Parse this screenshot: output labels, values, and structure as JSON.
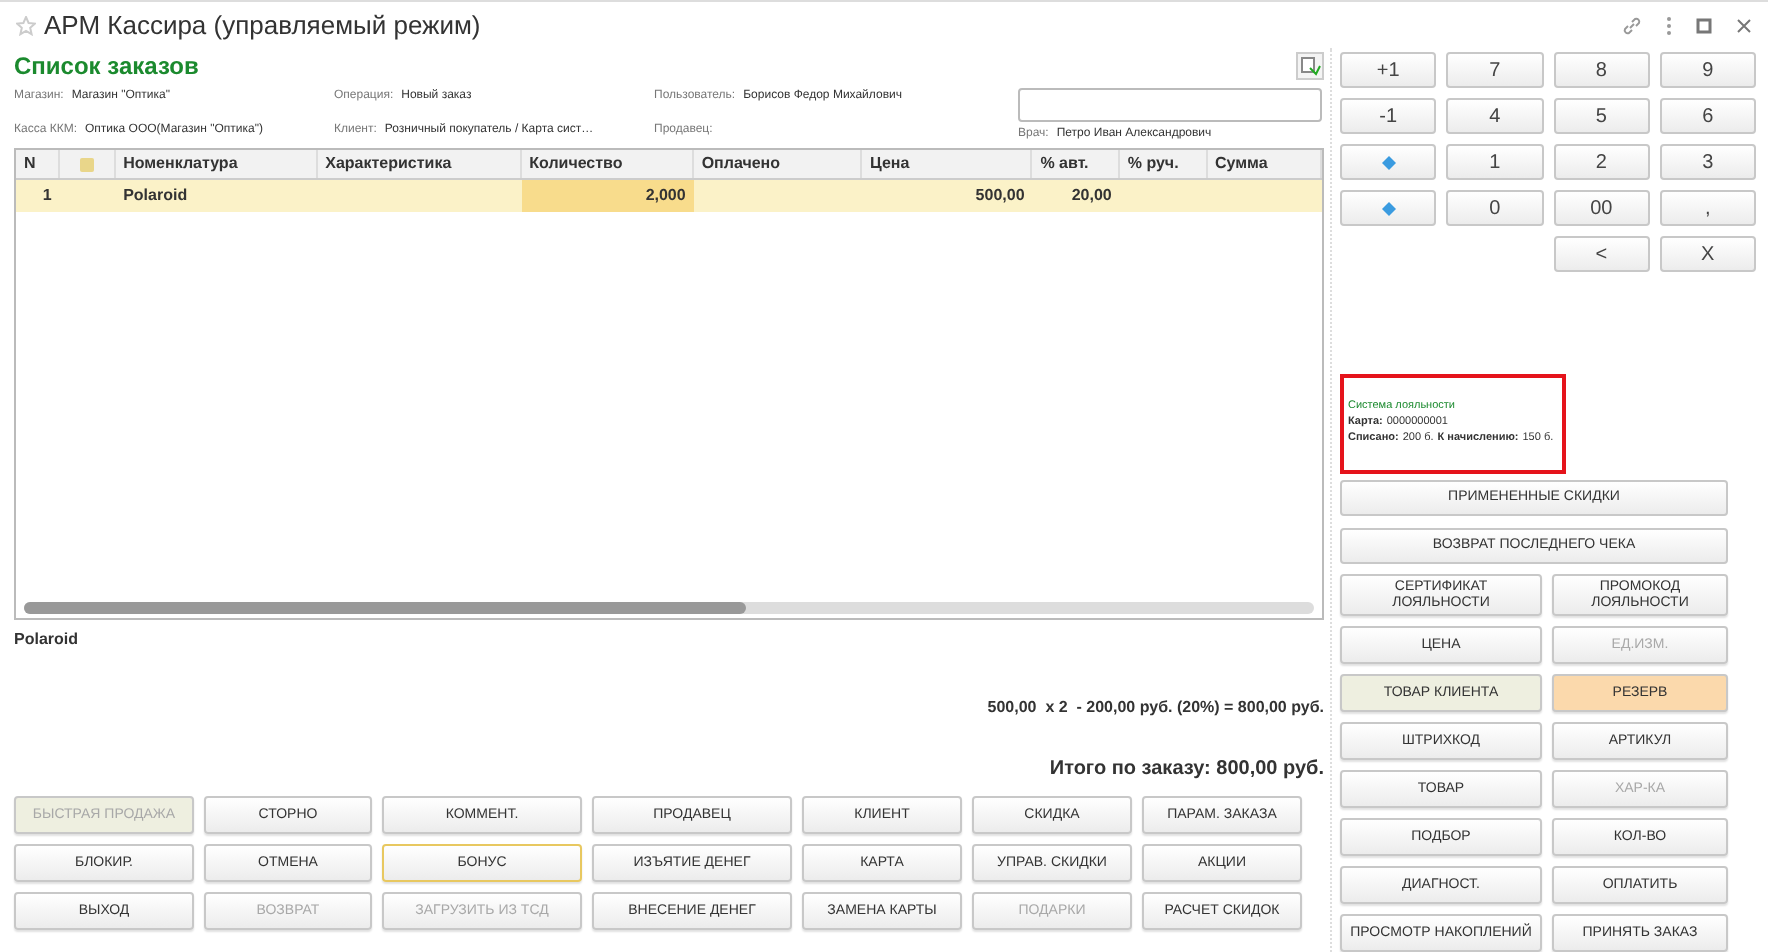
{
  "window": {
    "title": "АРМ Кассира (управляемый режим)"
  },
  "form": {
    "title": "Список заказов"
  },
  "info": [
    {
      "label": "Магазин:",
      "value": "Магазин \"Оптика\""
    },
    {
      "label": "Операция:",
      "value": "Новый заказ"
    },
    {
      "label": "Пользователь:",
      "value": "Борисов Федор Михайлович"
    },
    {
      "label": "Касса ККМ:",
      "value": "Оптика ООО(Магазин \"Оптика\")"
    },
    {
      "label": "Клиент:",
      "value": "Розничный покупатель / Карта сист…"
    },
    {
      "label": "Продавец:"
    }
  ],
  "doctor": {
    "label": "Врач:",
    "value": "Петро Иван Александрович"
  },
  "table": {
    "columns": [
      "N",
      "Номенклатура",
      "Характеристика",
      "Количество",
      "Оплачено",
      "Цена",
      "% авт.",
      "% руч.",
      "Сумма"
    ],
    "rows": [
      {
        "selected": true,
        "cells": [
          {
            "text": "1",
            "focused": false
          },
          {
            "text": "Polaroid",
            "focused": false
          },
          {
            "focused": false
          },
          {
            "text": "2,000",
            "focused": true
          },
          {
            "focused": false
          },
          {
            "text": "500,00",
            "focused": false
          },
          {
            "text": "20,00",
            "focused": false
          },
          {
            "focused": false
          },
          {
            "focused": false
          }
        ]
      }
    ]
  },
  "summary": {
    "item": "Polaroid",
    "calc": "500,00  x 2  - 200,00 руб. (20%) = 800,00 руб.",
    "total": "Итого по заказу: 800,00 руб."
  },
  "bottom_buttons": [
    {
      "label": "БЫСТРАЯ ПРОДАЖА",
      "kind": "olive",
      "disabled": true,
      "focused": false
    },
    {
      "label": "СТОРНО",
      "kind": "plain",
      "disabled": false,
      "focused": false
    },
    {
      "label": "КОММЕНТ.",
      "kind": "plain",
      "disabled": false,
      "focused": false
    },
    {
      "label": "ПРОДАВЕЦ",
      "kind": "plain",
      "disabled": false,
      "focused": false
    },
    {
      "label": "КЛИЕНТ",
      "kind": "plain",
      "disabled": false,
      "focused": false
    },
    {
      "label": "СКИДКА",
      "kind": "plain",
      "disabled": false,
      "focused": false
    },
    {
      "label": "ПАРАМ. ЗАКАЗА",
      "kind": "plain",
      "disabled": false,
      "focused": false
    },
    {
      "label": "БЛОКИР.",
      "kind": "plain",
      "disabled": false,
      "focused": false
    },
    {
      "label": "ОТМЕНА",
      "kind": "plain",
      "disabled": false,
      "focused": false
    },
    {
      "label": "БОНУС",
      "kind": "plain",
      "disabled": false,
      "focused": true
    },
    {
      "label": "ИЗЪЯТИЕ ДЕНЕГ",
      "kind": "plain",
      "disabled": false,
      "focused": false
    },
    {
      "label": "КАРТА",
      "kind": "plain",
      "disabled": false,
      "focused": false
    },
    {
      "label": "УПРАВ. СКИДКИ",
      "kind": "plain",
      "disabled": false,
      "focused": false
    },
    {
      "label": "АКЦИИ",
      "kind": "plain",
      "disabled": false,
      "focused": false
    },
    {
      "label": "ВЫХОД",
      "kind": "plain",
      "disabled": false,
      "focused": false
    },
    {
      "label": "ВОЗВРАТ",
      "kind": "plain",
      "disabled": true,
      "focused": false
    },
    {
      "label": "ЗАГРУЗИТЬ ИЗ ТСД",
      "kind": "plain",
      "disabled": true,
      "focused": false
    },
    {
      "label": "ВНЕСЕНИЕ ДЕНЕГ",
      "kind": "plain",
      "disabled": false,
      "focused": false
    },
    {
      "label": "ЗАМЕНА КАРТЫ",
      "kind": "plain",
      "disabled": false,
      "focused": false
    },
    {
      "label": "ПОДАРКИ",
      "kind": "plain",
      "disabled": true,
      "focused": false
    },
    {
      "label": "РАСЧЕТ СКИДОК",
      "kind": "plain",
      "disabled": false,
      "focused": false
    }
  ],
  "keypad": [
    {
      "label": "+1",
      "kind": "text"
    },
    {
      "label": "7",
      "kind": "text"
    },
    {
      "label": "8",
      "kind": "text"
    },
    {
      "label": "9",
      "kind": "text"
    },
    {
      "label": "-1",
      "kind": "text"
    },
    {
      "label": "4",
      "kind": "text"
    },
    {
      "label": "5",
      "kind": "text"
    },
    {
      "label": "6",
      "kind": "text"
    },
    {
      "kind": "dot"
    },
    {
      "label": "1",
      "kind": "text"
    },
    {
      "label": "2",
      "kind": "text"
    },
    {
      "label": "3",
      "kind": "text"
    },
    {
      "kind": "dot"
    },
    {
      "label": "0",
      "kind": "text"
    },
    {
      "label": "00",
      "kind": "text"
    },
    {
      "label": ",",
      "kind": "text"
    },
    {
      "kind": "blank"
    },
    {
      "kind": "blank"
    },
    {
      "label": "<",
      "kind": "text"
    },
    {
      "label": "X",
      "kind": "text"
    }
  ],
  "loyalty": {
    "title": "Система лояльности",
    "card_label": "Карта:",
    "card": "0000000001",
    "spent_label": "Списано:",
    "spent": "200 б.",
    "accrual_label": "К начислению:",
    "accrual": "150 б."
  },
  "wide_buttons": [
    {
      "label": "ПРИМЕНЕННЫЕ СКИДКИ"
    },
    {
      "label": "ВОЗВРАТ ПОСЛЕДНЕГО ЧЕКА"
    }
  ],
  "side_buttons": [
    {
      "label": "СЕРТИФИКАТ ЛОЯЛЬНОСТИ",
      "kind": "plain",
      "disabled": false
    },
    {
      "label": "ПРОМОКОД ЛОЯЛЬНОСТИ",
      "kind": "plain",
      "disabled": false
    },
    {
      "label": "ЦЕНА",
      "kind": "plain",
      "disabled": false
    },
    {
      "label": "ЕД.ИЗМ.",
      "kind": "plain",
      "disabled": true
    },
    {
      "label": "ТОВАР КЛИЕНТА",
      "kind": "olive",
      "disabled": false
    },
    {
      "label": "РЕЗЕРВ",
      "kind": "peach",
      "disabled": false
    },
    {
      "label": "ШТРИХКОД",
      "kind": "plain",
      "disabled": false
    },
    {
      "label": "АРТИКУЛ",
      "kind": "plain",
      "disabled": false
    },
    {
      "label": "ТОВАР",
      "kind": "plain",
      "disabled": false
    },
    {
      "label": "ХАР-КА",
      "kind": "plain",
      "disabled": true
    },
    {
      "label": "ПОДБОР",
      "kind": "plain",
      "disabled": false
    },
    {
      "label": "КОЛ-ВО",
      "kind": "plain",
      "disabled": false
    },
    {
      "label": "ДИАГНОСТ.",
      "kind": "plain",
      "disabled": false
    },
    {
      "label": "ОПЛАТИТЬ",
      "kind": "plain",
      "disabled": false
    },
    {
      "label": "ПРОСМОТР НАКОПЛЕНИЙ",
      "kind": "plain",
      "disabled": false
    },
    {
      "label": "ПРИНЯТЬ ЗАКАЗ",
      "kind": "plain",
      "disabled": false
    }
  ]
}
